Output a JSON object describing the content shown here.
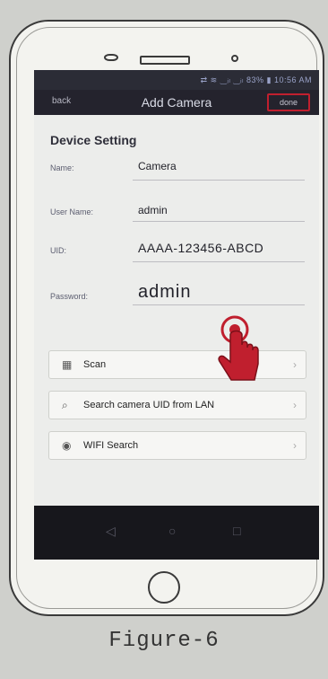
{
  "status_bar": {
    "text": "⇄ ≋ ‿ᵢₗ ‿ᵢₗ 83% ▮ 10:56 AM"
  },
  "header": {
    "back_label": "back",
    "title": "Add Camera",
    "done_label": "done"
  },
  "section_title": "Device Setting",
  "fields": [
    {
      "label": "Name:",
      "value": "Camera"
    },
    {
      "label": "User Name:",
      "value": "admin"
    },
    {
      "label": "UID:",
      "value": "AAAA-123456-ABCD"
    },
    {
      "label": "Password:",
      "value": "admin"
    }
  ],
  "menu": [
    {
      "icon": "scan-icon",
      "label": "Scan"
    },
    {
      "icon": "search-icon",
      "label": "Search camera UID from LAN"
    },
    {
      "icon": "wifi-icon",
      "label": "WIFI Search"
    }
  ],
  "caption": "Figure-6",
  "colors": {
    "accent": "#c01f2e",
    "header_bg": "#24232d",
    "content_bg": "#ecedeb"
  }
}
